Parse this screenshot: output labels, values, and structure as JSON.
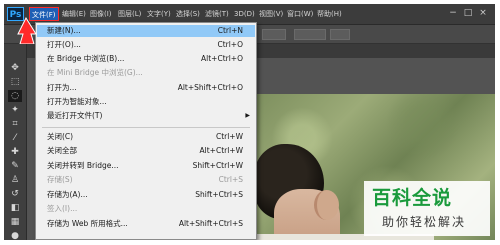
{
  "app": {
    "logo": "Ps"
  },
  "menubar": {
    "items": [
      {
        "label": "文件(F)"
      },
      {
        "label": "编辑(E)"
      },
      {
        "label": "图像(I)"
      },
      {
        "label": "图层(L)"
      },
      {
        "label": "文字(Y)"
      },
      {
        "label": "选择(S)"
      },
      {
        "label": "滤镜(T)"
      },
      {
        "label": "3D(D)"
      },
      {
        "label": "视图(V)"
      },
      {
        "label": "窗口(W)"
      },
      {
        "label": "帮助(H)"
      }
    ],
    "active_index": 0,
    "window_buttons": {
      "minimize": "−",
      "maximize": "□",
      "close": "×"
    }
  },
  "file_menu": {
    "items": [
      {
        "label": "新建(N)...",
        "shortcut": "Ctrl+N",
        "state": "highlighted"
      },
      {
        "label": "打开(O)...",
        "shortcut": "Ctrl+O",
        "state": "enabled"
      },
      {
        "label": "在 Bridge 中浏览(B)...",
        "shortcut": "Alt+Ctrl+O",
        "state": "enabled"
      },
      {
        "label": "在 Mini Bridge 中浏览(G)...",
        "shortcut": "",
        "state": "disabled"
      },
      {
        "label": "打开为...",
        "shortcut": "Alt+Shift+Ctrl+O",
        "state": "enabled"
      },
      {
        "label": "打开为智能对象...",
        "shortcut": "",
        "state": "enabled"
      },
      {
        "label": "最近打开文件(T)",
        "shortcut": "",
        "state": "enabled",
        "submenu": true
      },
      {
        "separator": true
      },
      {
        "label": "关闭(C)",
        "shortcut": "Ctrl+W",
        "state": "enabled"
      },
      {
        "label": "关闭全部",
        "shortcut": "Alt+Ctrl+W",
        "state": "enabled"
      },
      {
        "label": "关闭并转到 Bridge...",
        "shortcut": "Shift+Ctrl+W",
        "state": "enabled"
      },
      {
        "label": "存储(S)",
        "shortcut": "Ctrl+S",
        "state": "disabled"
      },
      {
        "label": "存储为(A)...",
        "shortcut": "Shift+Ctrl+S",
        "state": "enabled"
      },
      {
        "label": "签入(I)...",
        "shortcut": "",
        "state": "disabled"
      },
      {
        "label": "存储为 Web 所用格式...",
        "shortcut": "Alt+Shift+Ctrl+S",
        "state": "enabled"
      }
    ]
  },
  "watermark": {
    "title": "百科全说",
    "subtitle": "助你轻松解决"
  },
  "colors": {
    "highlight": "#91c9f7",
    "menu_bg": "#f0f0f0",
    "annotation": "#ff2a2a",
    "watermark_green": "#1a9a3c"
  }
}
